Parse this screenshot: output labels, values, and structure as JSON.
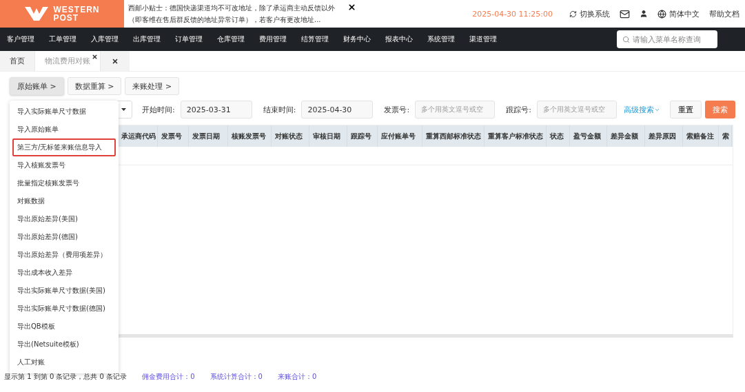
{
  "header": {
    "logo": {
      "line1": "WESTERN",
      "line2": "POST"
    },
    "notice": "西邮小贴士：德国快递渠道均不可改地址，除了承运商主动反馈以外（即客维在售后群反馈的地址异常订单），若客户有更改地址...",
    "datetime": "2025-04-30 11:25:00",
    "switch_label": "切换系统",
    "language": "简体中文",
    "help": "帮助文档"
  },
  "nav": {
    "items": [
      "客户管理",
      "工单管理",
      "入库管理",
      "出库管理",
      "订单管理",
      "仓库管理",
      "费用管理",
      "结算管理",
      "财务中心",
      "报表中心",
      "系统管理",
      "渠道管理"
    ],
    "search_placeholder": "请输入菜单名称查询"
  },
  "tabs": [
    {
      "label": "首页",
      "selected": false
    },
    {
      "label": "物流费用对账",
      "selected": true
    }
  ],
  "sub_buttons": [
    {
      "label": "原始账单 >",
      "selected": true
    },
    {
      "label": "数据重算 >",
      "selected": false
    },
    {
      "label": "来账处理 >",
      "selected": false
    }
  ],
  "filters": {
    "start_label": "开始时间:",
    "start_value": "2025-03-31",
    "end_label": "结束时间:",
    "end_value": "2025-04-30",
    "invoice_label": "发票号:",
    "invoice_placeholder": "多个用英文逗号或空",
    "tracking_label": "跟踪号:",
    "tracking_placeholder": "多个用英文逗号或空",
    "advanced": "高级搜索",
    "reset": "重置",
    "search": "搜索"
  },
  "menu": [
    {
      "label": "导入实际账单尺寸数据",
      "selected": false
    },
    {
      "label": "导入原始账单",
      "selected": false
    },
    {
      "label": "第三方/无标签来账信息导入",
      "selected": true
    },
    {
      "label": "导入核账发票号",
      "selected": false
    },
    {
      "label": "批量指定核账发票号",
      "selected": false
    },
    {
      "label": "对账数据",
      "selected": false
    },
    {
      "label": "导出原始差异(美国)",
      "selected": false
    },
    {
      "label": "导出原始差异(德国)",
      "selected": false
    },
    {
      "label": "导出原始差异（费用项差异）",
      "selected": false
    },
    {
      "label": "导出成本收入差异",
      "selected": false
    },
    {
      "label": "导出实际账单尺寸数据(美国)",
      "selected": false
    },
    {
      "label": "导出实际账单尺寸数据(德国)",
      "selected": false
    },
    {
      "label": "导出QB模板",
      "selected": false
    },
    {
      "label": "导出(Netsuite模板)",
      "selected": false
    },
    {
      "label": "人工对账",
      "selected": false
    }
  ],
  "table": {
    "columns": [
      "承运商代码",
      "发票号",
      "发票日期",
      "核账发票号",
      "对账状态",
      "审核日期",
      "跟踪号",
      "应付账单号",
      "重算西邮标准状态",
      "重算客户标准状态",
      "状态",
      "盈亏金额",
      "差异金额",
      "差异原因",
      "索赔备注",
      "索"
    ]
  },
  "footer": {
    "records": "显示第 1 到第 0 条记录，总共 0 条记录",
    "totals": [
      "佣金费用合计：0",
      "系统计算合计：0",
      "来账合计：0"
    ]
  }
}
